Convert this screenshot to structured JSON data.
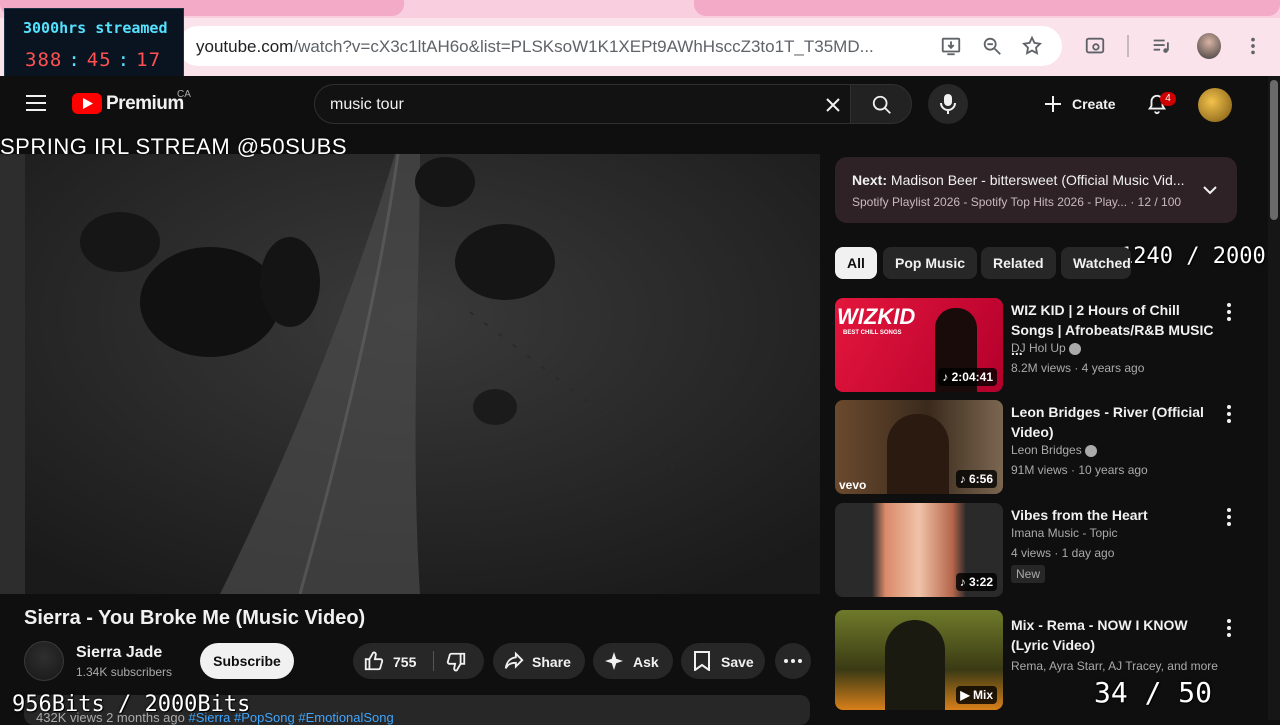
{
  "browser": {
    "url_host": "youtube.com",
    "url_rest": "/watch?v=cX3c1ltAH6o&list=PLSKsoW1K1XEPt9AWhHsccZ3to1T_T35MD..."
  },
  "overlay": {
    "timer_title": "3000hrs streamed",
    "timer_h": "388",
    "timer_m": "45",
    "timer_s": "17",
    "stream_title": "SPRING IRL STREAM @50SUBS",
    "goal_top": "1240 / 2000",
    "bits_counter": "956Bits / 2000Bits",
    "subs_counter": "34 / 50"
  },
  "header": {
    "logo_text": "Premium",
    "region": "CA",
    "search_value": "music tour",
    "create_label": "Create",
    "notification_count": "4"
  },
  "video": {
    "title": "Sierra - You Broke Me (Music Video)",
    "channel": "Sierra Jade",
    "subscribers": "1.34K subscribers",
    "subscribe_label": "Subscribe",
    "likes": "755",
    "share_label": "Share",
    "ask_label": "Ask",
    "save_label": "Save",
    "desc_meta": "432K views  2 months ago",
    "desc_tags": "#Sierra #PopSong #EmotionalSong"
  },
  "playlist": {
    "next_prefix": "Next:",
    "next_title": "Madison Beer - bittersweet (Official Music Vid...",
    "next_sub": "Spotify Playlist 2026 - Spotify Top Hits 2026 - Play...  · 12 / 100"
  },
  "chips": [
    "All",
    "Pop Music",
    "Related",
    "Watched"
  ],
  "recommendations": [
    {
      "title": "WIZ KID | 2 Hours of Chill Songs | Afrobeats/R&B MUSIC ...",
      "channel": "DJ Hol Up",
      "meta": "8.2M views · 4 years ago",
      "duration": "2:04:41",
      "thumb_text": "WIZKID",
      "thumb_sub": "BEST CHILL SONGS"
    },
    {
      "title": "Leon Bridges - River (Official Video)",
      "channel": "Leon Bridges",
      "meta": "91M views · 10 years ago",
      "duration": "6:56",
      "thumb_text": "vevo"
    },
    {
      "title": "Vibes from the Heart",
      "channel": "Imana Music - Topic",
      "meta": "4 views · 1 day ago",
      "duration": "3:22",
      "badge": "New"
    },
    {
      "title": "Mix - Rema - NOW I KNOW (Lyric Video)",
      "channel": "Rema, Ayra Starr, AJ Tracey, and more",
      "duration": "Mix"
    }
  ],
  "colors": {
    "brand_red": "#ff0000",
    "accent_blue": "#3ea6ff",
    "timer_cyan": "#55e2ff",
    "timer_red": "#ff5151"
  }
}
